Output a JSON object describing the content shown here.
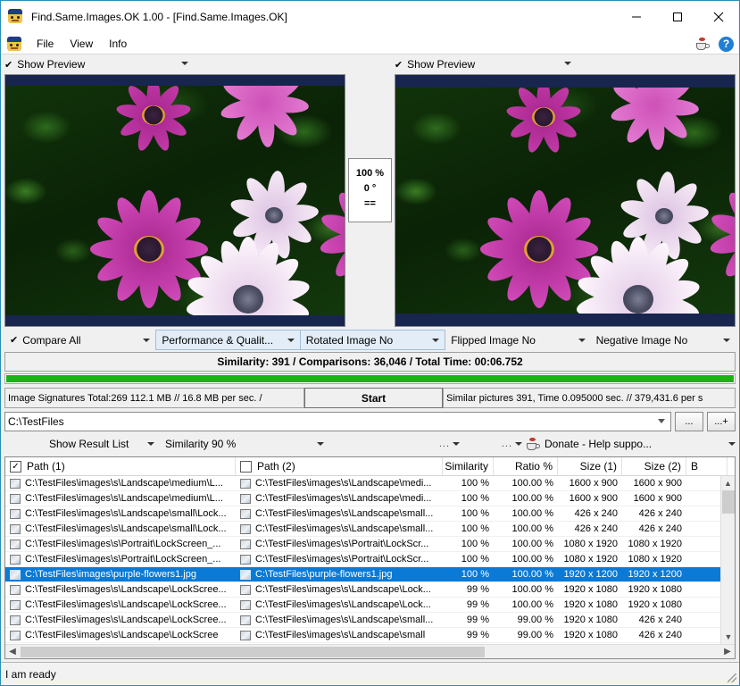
{
  "window": {
    "title": "Find.Same.Images.OK 1.00 - [Find.Same.Images.OK]",
    "minimize": "–",
    "maximize": "☐",
    "close": "✕"
  },
  "menu": {
    "items": [
      "File",
      "View",
      "Info"
    ],
    "donate_icon": "coffee-icon",
    "help_icon": "help-icon",
    "help_label": "?"
  },
  "preview": {
    "left": {
      "check": "✔",
      "label": "Show Preview"
    },
    "right": {
      "check": "✔",
      "label": "Show Preview"
    },
    "center": {
      "zoom": "100 %",
      "angle": "0 °",
      "equal": "=="
    }
  },
  "options": [
    {
      "label": "Compare All",
      "check": "✔"
    },
    {
      "label": "Performance & Qualit...",
      "check": ""
    },
    {
      "label": "Rotated Image No",
      "check": ""
    },
    {
      "label": "Flipped Image No",
      "check": ""
    },
    {
      "label": "Negative Image No",
      "check": ""
    }
  ],
  "summary": {
    "text": "Similarity: 391 / Comparisons: 36,046 / Total Time: 00:06.752",
    "progress_percent": 100,
    "progress_color": "#19b319"
  },
  "stats": {
    "left": "Image Signatures Total:269  112.1 MB // 16.8 MB per sec. /",
    "start_label": "Start",
    "right": "Similar pictures 391, Time 0.095000 sec. // 379,431.6 per s"
  },
  "path": {
    "value": "C:\\TestFiles",
    "browse_label": "...",
    "add_label": "...+"
  },
  "result_toolbar": {
    "show_result_list": "Show Result List",
    "similarity": "Similarity 90 %",
    "dots1": "...",
    "dots2": "...",
    "donate": "Donate - Help suppo..."
  },
  "table": {
    "headers": {
      "path1": "Path (1)",
      "path2": "Path (2)",
      "similarity": "Similarity",
      "ratio": "Ratio %",
      "size1": "Size (1)",
      "size2": "Size (2)",
      "b": "B"
    },
    "path1_checked": true,
    "path2_checked": false,
    "rows": [
      {
        "path1": "C:\\TestFiles\\images\\s\\Landscape\\medium\\L...",
        "path2": "C:\\TestFiles\\images\\s\\Landscape\\medi...",
        "similarity": "100 %",
        "ratio": "100.00 %",
        "size1": "1600 x 900",
        "size2": "1600 x 900",
        "selected": false
      },
      {
        "path1": "C:\\TestFiles\\images\\s\\Landscape\\medium\\L...",
        "path2": "C:\\TestFiles\\images\\s\\Landscape\\medi...",
        "similarity": "100 %",
        "ratio": "100.00 %",
        "size1": "1600 x 900",
        "size2": "1600 x 900",
        "selected": false
      },
      {
        "path1": "C:\\TestFiles\\images\\s\\Landscape\\small\\Lock...",
        "path2": "C:\\TestFiles\\images\\s\\Landscape\\small...",
        "similarity": "100 %",
        "ratio": "100.00 %",
        "size1": "426 x 240",
        "size2": "426 x 240",
        "selected": false
      },
      {
        "path1": "C:\\TestFiles\\images\\s\\Landscape\\small\\Lock...",
        "path2": "C:\\TestFiles\\images\\s\\Landscape\\small...",
        "similarity": "100 %",
        "ratio": "100.00 %",
        "size1": "426 x 240",
        "size2": "426 x 240",
        "selected": false
      },
      {
        "path1": "C:\\TestFiles\\images\\s\\Portrait\\LockScreen_...",
        "path2": "C:\\TestFiles\\images\\s\\Portrait\\LockScr...",
        "similarity": "100 %",
        "ratio": "100.00 %",
        "size1": "1080 x 1920",
        "size2": "1080 x 1920",
        "selected": false
      },
      {
        "path1": "C:\\TestFiles\\images\\s\\Portrait\\LockScreen_...",
        "path2": "C:\\TestFiles\\images\\s\\Portrait\\LockScr...",
        "similarity": "100 %",
        "ratio": "100.00 %",
        "size1": "1080 x 1920",
        "size2": "1080 x 1920",
        "selected": false
      },
      {
        "path1": "C:\\TestFiles\\images\\purple-flowers1.jpg",
        "path2": "C:\\TestFiles\\purple-flowers1.jpg",
        "similarity": "100 %",
        "ratio": "100.00 %",
        "size1": "1920 x 1200",
        "size2": "1920 x 1200",
        "selected": true
      },
      {
        "path1": "C:\\TestFiles\\images\\s\\Landscape\\LockScree...",
        "path2": "C:\\TestFiles\\images\\s\\Landscape\\Lock...",
        "similarity": "99 %",
        "ratio": "100.00 %",
        "size1": "1920 x 1080",
        "size2": "1920 x 1080",
        "selected": false
      },
      {
        "path1": "C:\\TestFiles\\images\\s\\Landscape\\LockScree...",
        "path2": "C:\\TestFiles\\images\\s\\Landscape\\Lock...",
        "similarity": "99 %",
        "ratio": "100.00 %",
        "size1": "1920 x 1080",
        "size2": "1920 x 1080",
        "selected": false
      },
      {
        "path1": "C:\\TestFiles\\images\\s\\Landscape\\LockScree...",
        "path2": "C:\\TestFiles\\images\\s\\Landscape\\small...",
        "similarity": "99 %",
        "ratio": "99.00 %",
        "size1": "1920 x 1080",
        "size2": "426 x 240",
        "selected": false
      },
      {
        "path1": "C:\\TestFiles\\images\\s\\Landscape\\LockScree",
        "path2": "C:\\TestFiles\\images\\s\\Landscape\\small",
        "similarity": "99 %",
        "ratio": "99.00 %",
        "size1": "1920 x 1080",
        "size2": "426 x 240",
        "selected": false
      }
    ]
  },
  "statusbar": {
    "text": "I am ready"
  },
  "colors": {
    "selection": "#0b7ad6",
    "progress": "#19b319",
    "accent_border": "#2a8fb5",
    "photo_frame": "#17254f"
  }
}
